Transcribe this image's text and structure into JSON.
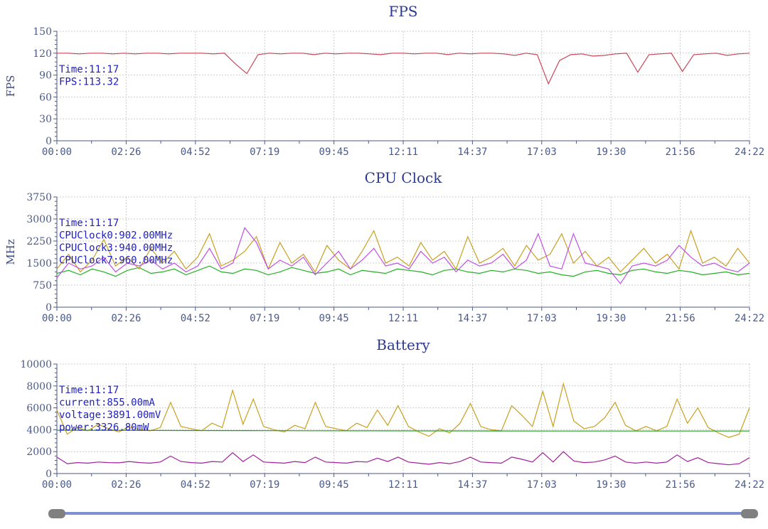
{
  "chart_data": [
    {
      "type": "line",
      "title": "FPS",
      "ylabel": "FPS",
      "ylim": [
        0,
        150
      ],
      "yticks": [
        0,
        30,
        60,
        90,
        120,
        150
      ],
      "xticks": [
        "00:00",
        "02:26",
        "04:52",
        "07:19",
        "09:45",
        "12:11",
        "14:37",
        "17:03",
        "19:30",
        "21:56",
        "24:22"
      ],
      "tooltip": [
        "Time:11:17",
        "FPS:113.32"
      ],
      "series": [
        {
          "name": "FPS",
          "color": "#c8485a",
          "values": [
            120,
            120,
            119,
            120,
            120,
            119,
            120,
            119,
            120,
            120,
            119,
            120,
            120,
            120,
            119,
            120,
            105,
            92,
            118,
            120,
            119,
            120,
            120,
            118,
            120,
            119,
            120,
            120,
            119,
            118,
            120,
            120,
            119,
            120,
            120,
            118,
            120,
            119,
            120,
            120,
            119,
            117,
            120,
            118,
            78,
            110,
            118,
            119,
            116,
            117,
            119,
            120,
            94,
            118,
            119,
            120,
            95,
            118,
            119,
            120,
            117,
            119,
            120
          ]
        }
      ]
    },
    {
      "type": "line",
      "title": "CPU Clock",
      "ylabel": "MHz",
      "ylim": [
        0,
        3750
      ],
      "yticks": [
        0,
        750,
        1500,
        2250,
        3000,
        3750
      ],
      "xticks": [
        "00:00",
        "02:26",
        "04:52",
        "07:19",
        "09:45",
        "12:11",
        "14:37",
        "17:03",
        "19:30",
        "21:56",
        "24:22"
      ],
      "tooltip": [
        "Time:11:17",
        "CPUClock0:902.00MHz",
        "CPUClock3:940.00MHz",
        "CPUClock7:960.00MHz"
      ],
      "series": [
        {
          "name": "CPUClock0",
          "color": "#22b022",
          "values": [
            1150,
            1250,
            1100,
            1300,
            1200,
            1050,
            1250,
            1350,
            1150,
            1200,
            1300,
            1100,
            1250,
            1400,
            1200,
            1150,
            1300,
            1250,
            1100,
            1200,
            1350,
            1250,
            1150,
            1200,
            1300,
            1100,
            1250,
            1200,
            1150,
            1300,
            1250,
            1200,
            1100,
            1250,
            1300,
            1200,
            1150,
            1250,
            1200,
            1300,
            1250,
            1150,
            1200,
            1100,
            1050,
            1200,
            1250,
            1150,
            1100,
            1250,
            1300,
            1200,
            1150,
            1250,
            1200,
            1100,
            1150,
            1200,
            1100,
            1150
          ]
        },
        {
          "name": "CPUClock3",
          "color": "#c8a020",
          "values": [
            1300,
            1800,
            1200,
            1600,
            2300,
            1400,
            1700,
            1300,
            2000,
            1500,
            1900,
            1300,
            1700,
            2500,
            1400,
            1600,
            1900,
            2400,
            1300,
            2200,
            1500,
            1800,
            1200,
            2100,
            1600,
            1300,
            1900,
            2600,
            1500,
            1700,
            1400,
            2200,
            1600,
            1900,
            1300,
            2400,
            1500,
            1700,
            2000,
            1400,
            2100,
            1600,
            1800,
            2500,
            1500,
            1900,
            1400,
            1700,
            1200,
            1600,
            2000,
            1500,
            1800,
            1300,
            2600,
            1500,
            1700,
            1400,
            2000,
            1500
          ]
        },
        {
          "name": "CPUClock7",
          "color": "#c050e0",
          "values": [
            1000,
            1500,
            1300,
            1400,
            1700,
            1200,
            1500,
            1400,
            1600,
            1300,
            1500,
            1200,
            1400,
            2000,
            1300,
            1500,
            2700,
            2200,
            1300,
            1600,
            1400,
            1700,
            1100,
            1500,
            1900,
            1300,
            1600,
            2000,
            1400,
            1500,
            1300,
            1900,
            1500,
            1700,
            1200,
            1600,
            1400,
            1500,
            1800,
            1300,
            1600,
            2500,
            1400,
            1300,
            2500,
            1500,
            1400,
            1300,
            800,
            1400,
            1500,
            1400,
            1600,
            2100,
            1700,
            1400,
            1500,
            1300,
            1200,
            1500
          ]
        }
      ]
    },
    {
      "type": "line",
      "title": "Battery",
      "ylabel": "",
      "ylim": [
        0,
        10000
      ],
      "yticks": [
        0,
        2000,
        4000,
        6000,
        8000,
        10000
      ],
      "xticks": [
        "00:00",
        "02:26",
        "04:52",
        "07:19",
        "09:45",
        "12:11",
        "14:37",
        "17:03",
        "19:30",
        "21:56",
        "24:22"
      ],
      "tooltip": [
        "Time:11:17",
        "current:855.00mA",
        "voltage:3891.00mV",
        "power:3326.80mW"
      ],
      "series": [
        {
          "name": "power",
          "color": "#c8a020",
          "values": [
            5800,
            3600,
            4200,
            3900,
            4500,
            4100,
            3800,
            4300,
            4000,
            3900,
            4200,
            6500,
            4300,
            4100,
            3900,
            4600,
            4200,
            7600,
            4500,
            6800,
            4300,
            4000,
            3800,
            4400,
            4100,
            6500,
            4300,
            4100,
            3900,
            4600,
            4200,
            5800,
            4400,
            6200,
            4300,
            3800,
            3400,
            4100,
            3700,
            4600,
            6400,
            4300,
            4000,
            3900,
            6200,
            5300,
            4300,
            7500,
            4300,
            8200,
            4800,
            4100,
            4300,
            5100,
            6500,
            4400,
            3900,
            4300,
            3900,
            4300,
            6800,
            4600,
            6000,
            4200,
            3700,
            3300,
            3600,
            6000
          ]
        },
        {
          "name": "voltage",
          "color": "#22a022",
          "values": [
            3950,
            3940,
            3930,
            3920,
            3910,
            3900,
            3895,
            3890,
            3885,
            3880,
            3880,
            3880
          ]
        },
        {
          "name": "current",
          "color": "#a0209a",
          "values": [
            1500,
            900,
            1000,
            950,
            1050,
            1000,
            980,
            1100,
            1000,
            950,
            1050,
            1600,
            1100,
            1000,
            950,
            1100,
            1050,
            1900,
            1100,
            1700,
            1050,
            1000,
            950,
            1100,
            1000,
            1500,
            1050,
            1000,
            950,
            1100,
            1050,
            1400,
            1100,
            1500,
            1050,
            950,
            850,
            1000,
            900,
            1100,
            1500,
            1050,
            1000,
            950,
            1500,
            1300,
            1050,
            1900,
            1050,
            2000,
            1150,
            1000,
            1050,
            1250,
            1600,
            1050,
            950,
            1050,
            950,
            1050,
            1700,
            1100,
            1450,
            1000,
            900,
            800,
            900,
            1450
          ]
        }
      ]
    }
  ],
  "scrollbar": {
    "start": 0,
    "end": 1,
    "track_color": "#8090d0",
    "handle_color": "#808080"
  }
}
